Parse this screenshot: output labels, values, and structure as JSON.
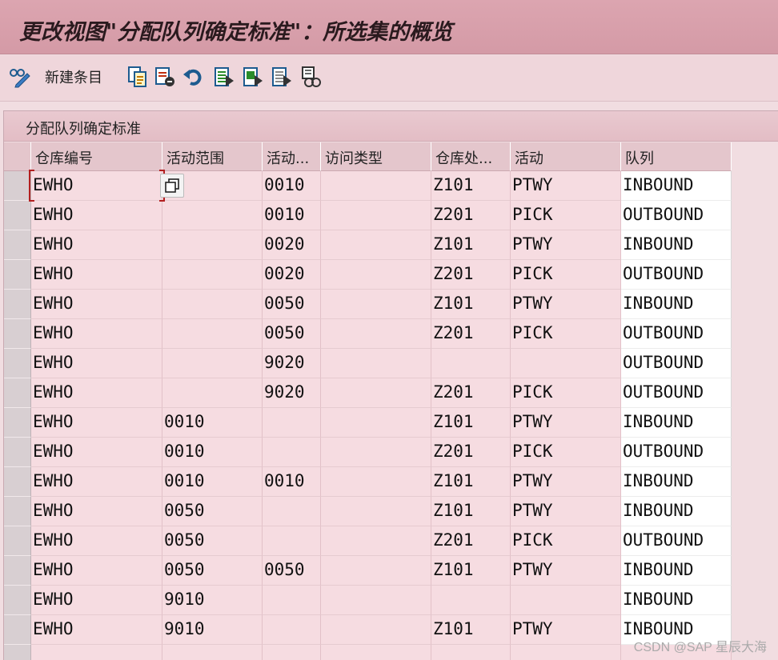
{
  "window": {
    "title": "更改视图\"分配队列确定标准\"：所选集的概览"
  },
  "toolbar": {
    "new_entries_label": "新建条目",
    "icons": [
      "change-display-icon",
      "copy-as-icon",
      "delete-icon",
      "undo-icon",
      "select-all-icon",
      "select-block-icon",
      "deselect-all-icon",
      "print-icon"
    ]
  },
  "panel": {
    "title": "分配队列确定标准"
  },
  "table": {
    "columns": [
      "仓库编号",
      "活动范围",
      "活动...",
      "访问类型",
      "仓库处...",
      "活动",
      "队列"
    ],
    "rows": [
      [
        "EWHO",
        "",
        "0010",
        "",
        "Z101",
        "PTWY",
        "INBOUND"
      ],
      [
        "EWHO",
        "",
        "0010",
        "",
        "Z201",
        "PICK",
        "OUTBOUND"
      ],
      [
        "EWHO",
        "",
        "0020",
        "",
        "Z101",
        "PTWY",
        "INBOUND"
      ],
      [
        "EWHO",
        "",
        "0020",
        "",
        "Z201",
        "PICK",
        "OUTBOUND"
      ],
      [
        "EWHO",
        "",
        "0050",
        "",
        "Z101",
        "PTWY",
        "INBOUND"
      ],
      [
        "EWHO",
        "",
        "0050",
        "",
        "Z201",
        "PICK",
        "OUTBOUND"
      ],
      [
        "EWHO",
        "",
        "9020",
        "",
        "",
        "",
        "OUTBOUND"
      ],
      [
        "EWHO",
        "",
        "9020",
        "",
        "Z201",
        "PICK",
        "OUTBOUND"
      ],
      [
        "EWHO",
        "0010",
        "",
        "",
        "Z101",
        "PTWY",
        "INBOUND"
      ],
      [
        "EWHO",
        "0010",
        "",
        "",
        "Z201",
        "PICK",
        "OUTBOUND"
      ],
      [
        "EWHO",
        "0010",
        "0010",
        "",
        "Z101",
        "PTWY",
        "INBOUND"
      ],
      [
        "EWHO",
        "0050",
        "",
        "",
        "Z101",
        "PTWY",
        "INBOUND"
      ],
      [
        "EWHO",
        "0050",
        "",
        "",
        "Z201",
        "PICK",
        "OUTBOUND"
      ],
      [
        "EWHO",
        "0050",
        "0050",
        "",
        "Z101",
        "PTWY",
        "INBOUND"
      ],
      [
        "EWHO",
        "9010",
        "",
        "",
        "",
        "",
        "INBOUND"
      ],
      [
        "EWHO",
        "9010",
        "",
        "",
        "Z101",
        "PTWY",
        "INBOUND"
      ],
      [
        "",
        "",
        "",
        "",
        "",
        "",
        ""
      ]
    ]
  },
  "watermark": "CSDN @SAP 星辰大海"
}
